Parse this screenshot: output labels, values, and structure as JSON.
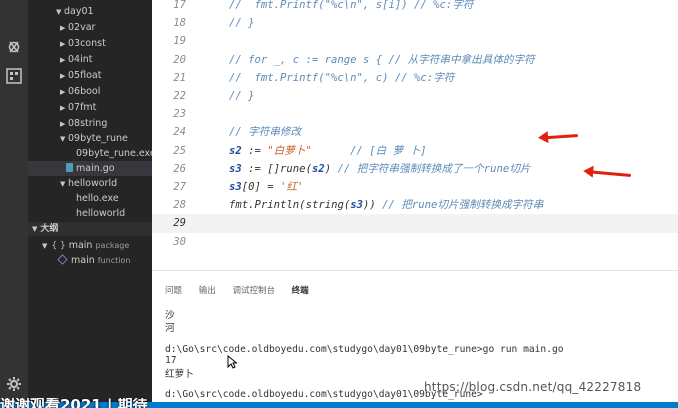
{
  "sidebar": {
    "tree": [
      {
        "label": "day01",
        "twisty": "▼"
      },
      {
        "label": "02var",
        "twisty": "▶"
      },
      {
        "label": "03const",
        "twisty": "▶"
      },
      {
        "label": "04int",
        "twisty": "▶"
      },
      {
        "label": "05float",
        "twisty": "▶"
      },
      {
        "label": "06bool",
        "twisty": "▶"
      },
      {
        "label": "07fmt",
        "twisty": "▶"
      },
      {
        "label": "08string",
        "twisty": "▶"
      },
      {
        "label": "09byte_rune",
        "twisty": "▼"
      },
      {
        "label": "09byte_rune.exe",
        "twisty": ""
      },
      {
        "label": "main.go",
        "twisty": ""
      },
      {
        "label": "helloworld",
        "twisty": "▼"
      },
      {
        "label": "hello.exe",
        "twisty": ""
      },
      {
        "label": "helloworld",
        "twisty": ""
      }
    ],
    "outline_title": "大纲",
    "outline": [
      {
        "label": "main",
        "kind": "package"
      },
      {
        "label": "main",
        "kind": "function"
      }
    ]
  },
  "editor": {
    "lines": [
      {
        "num": "17",
        "html": "<span class='cm'>//  fmt.Printf(\"%c\\n\", s[i]) // %c:字符</span>"
      },
      {
        "num": "18",
        "html": "<span class='cm'>// }</span>"
      },
      {
        "num": "19",
        "html": ""
      },
      {
        "num": "20",
        "html": "<span class='cm'>// for _, c := range s { // 从字符串中拿出具体的字符</span>"
      },
      {
        "num": "21",
        "html": "<span class='cm'>//  fmt.Printf(\"%c\\n\", c) // %c:字符</span>"
      },
      {
        "num": "22",
        "html": "<span class='cm'>// }</span>"
      },
      {
        "num": "23",
        "html": ""
      },
      {
        "num": "24",
        "html": "<span class='cm'>// 字符串修改</span>"
      },
      {
        "num": "25",
        "html": "<span class='var'>s2</span> := <span class='str'>\"白萝卜\"</span>      <span class='cm'>// [白 萝 卜]</span>"
      },
      {
        "num": "26",
        "html": "<span class='var'>s3</span> := []<span class='fn'>rune</span>(<span class='var'>s2</span>) <span class='cm'>// 把字符串强制转换成了一个rune切片</span>"
      },
      {
        "num": "27",
        "html": "<span class='var'>s3</span>[0] = <span class='str'>'红'</span>"
      },
      {
        "num": "28",
        "html": "<span class='fn'>fmt.Println</span>(<span class='fn'>string</span>(<span class='var'>s3</span>)) <span class='cm'>// 把rune切片强制转换成字符串</span>"
      },
      {
        "num": "29",
        "html": "",
        "current": true
      },
      {
        "num": "30",
        "html": ""
      }
    ]
  },
  "panel": {
    "tabs": [
      "问题",
      "输出",
      "调试控制台",
      "终端"
    ],
    "active_tab": "终端",
    "terminal": [
      "沙",
      "河",
      "",
      "d:\\Go\\src\\code.oldboyedu.com\\studygo\\day01\\09byte_rune>go run main.go",
      "17",
      "红萝卜",
      "d:\\Go\\src\\code.oldboyedu.com\\studygo\\day01\\09byte_rune>"
    ]
  },
  "watermark": "https://blog.csdn.net/qq_42227818",
  "subtitle": "谢谢观看2021 | 期待",
  "colors": {
    "sidebar": "#252526",
    "activitybar": "#333333",
    "arrow": "#e02010",
    "statusbar": "#007acc",
    "comment": "#5c8ab8"
  }
}
